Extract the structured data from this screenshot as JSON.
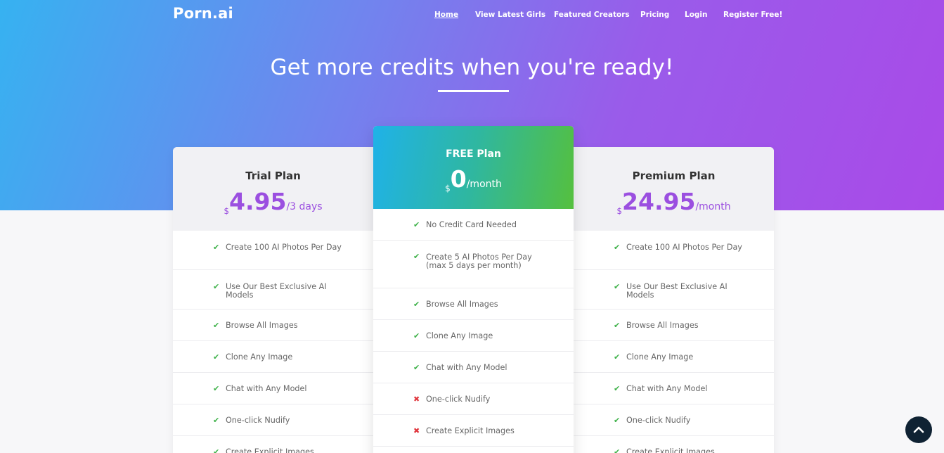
{
  "brand": "Porn.ai",
  "nav": [
    {
      "label": "Home",
      "active": true
    },
    {
      "label": "View Latest Girls",
      "active": false
    },
    {
      "label": "Featured Creators",
      "active": false
    },
    {
      "label": "Pricing",
      "active": false
    },
    {
      "label": "Login",
      "active": false
    },
    {
      "label": "Register Free!",
      "active": false
    }
  ],
  "headline": "Get more credits when you're ready!",
  "plans": {
    "trial": {
      "name": "Trial Plan",
      "currency": "$",
      "amount": "4.95",
      "period": "/3 days",
      "features": [
        {
          "text": "Create 100 AI Photos Per Day",
          "included": true
        },
        {
          "text": "Use Our Best Exclusive AI Models",
          "included": true
        },
        {
          "text": "Browse All Images",
          "included": true
        },
        {
          "text": "Clone Any Image",
          "included": true
        },
        {
          "text": "Chat with Any Model",
          "included": true
        },
        {
          "text": "One-click Nudify",
          "included": true
        },
        {
          "text": "Create Explicit Images",
          "included": true
        }
      ]
    },
    "free": {
      "name": "FREE Plan",
      "currency": "$",
      "amount": "0",
      "period": "/month",
      "features": [
        {
          "text": "No Credit Card Needed",
          "included": true
        },
        {
          "text": "Create 5 AI Photos Per Day (max 5 days per month)",
          "included": true
        },
        {
          "text": "Browse All Images",
          "included": true
        },
        {
          "text": "Clone Any Image",
          "included": true
        },
        {
          "text": "Chat with Any Model",
          "included": true
        },
        {
          "text": "One-click Nudify",
          "included": false
        },
        {
          "text": "Create Explicit Images",
          "included": false
        }
      ]
    },
    "premium": {
      "name": "Premium Plan",
      "currency": "$",
      "amount": "24.95",
      "period": "/month",
      "features": [
        {
          "text": "Create 100 AI Photos Per Day",
          "included": true
        },
        {
          "text": "Use Our Best Exclusive AI Models",
          "included": true
        },
        {
          "text": "Browse All Images",
          "included": true
        },
        {
          "text": "Clone Any Image",
          "included": true
        },
        {
          "text": "Chat with Any Model",
          "included": true
        },
        {
          "text": "One-click Nudify",
          "included": true
        },
        {
          "text": "Create Explicit Images",
          "included": true
        }
      ]
    }
  },
  "icons": {
    "included": "check-icon",
    "excluded": "cross-icon",
    "scroll_top": "chevron-up-icon"
  },
  "colors": {
    "accent_purple": "#9b4fe0",
    "check_green": "#3fb24a",
    "cross_red": "#e0343b"
  }
}
